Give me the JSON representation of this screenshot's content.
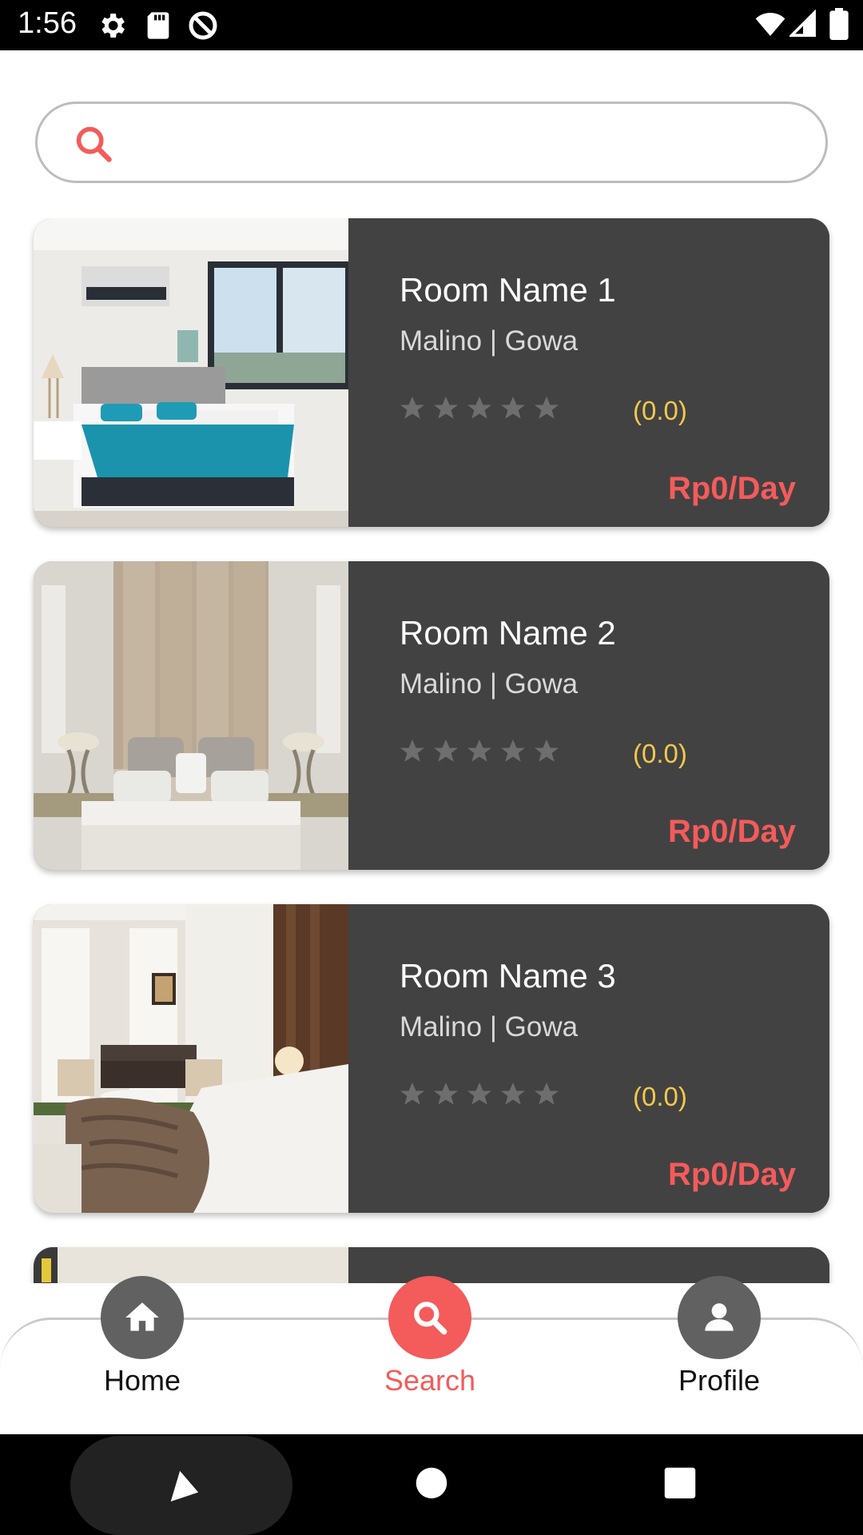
{
  "status_bar": {
    "time": "1:56"
  },
  "search": {
    "placeholder": "",
    "value": ""
  },
  "rooms": [
    {
      "name": "Room Name 1",
      "location": "Malino | Gowa",
      "rating": 0,
      "rating_text": "(0.0)",
      "price": "Rp0/Day",
      "photo": "bedroom-teal-bedding"
    },
    {
      "name": "Room Name 2",
      "location": "Malino | Gowa",
      "rating": 0,
      "rating_text": "(0.0)",
      "price": "Rp0/Day",
      "photo": "bedroom-beige-headboard"
    },
    {
      "name": "Room Name 3",
      "location": "Malino | Gowa",
      "rating": 0,
      "rating_text": "(0.0)",
      "price": "Rp0/Day",
      "photo": "bedroom-lounge-fur-throw"
    }
  ],
  "bottom_nav": {
    "items": [
      {
        "label": "Home",
        "icon": "home-icon",
        "active": false
      },
      {
        "label": "Search",
        "icon": "search-icon",
        "active": true
      },
      {
        "label": "Profile",
        "icon": "person-icon",
        "active": false
      }
    ]
  },
  "colors": {
    "accent": "#f45b5b",
    "card_bg": "#424242",
    "rating": "#f2c94c",
    "nav_icon_bg": "#616161"
  }
}
